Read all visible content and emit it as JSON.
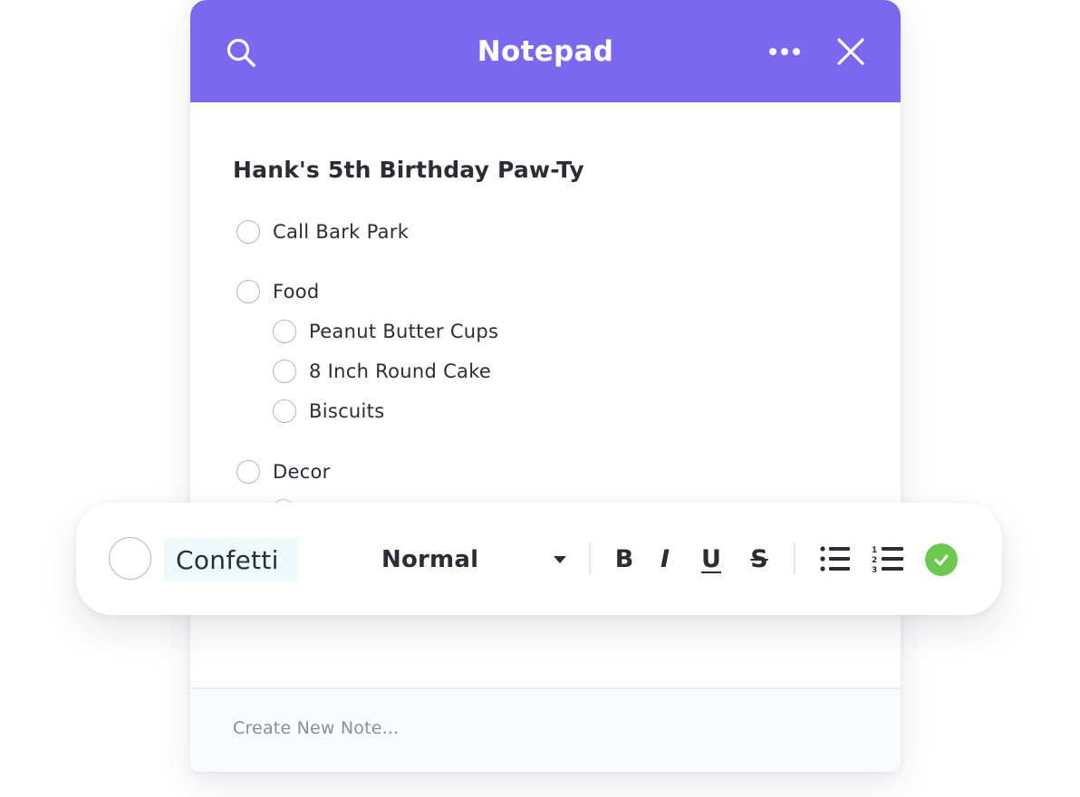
{
  "header": {
    "title": "Notepad",
    "search_icon": "search-icon",
    "more_icon": "more-horizontal-icon",
    "close_icon": "close-icon",
    "accent_color": "#7b68ee"
  },
  "note": {
    "title": "Hank's 5th Birthday Paw-Ty",
    "items": [
      {
        "label": "Call Bark Park",
        "checked": false,
        "indent": 0
      },
      {
        "label": "Food",
        "checked": false,
        "indent": 0
      },
      {
        "label": "Peanut Butter Cups",
        "checked": false,
        "indent": 1
      },
      {
        "label": "8 Inch Round Cake",
        "checked": false,
        "indent": 1
      },
      {
        "label": "Biscuits",
        "checked": false,
        "indent": 1
      },
      {
        "label": "Decor",
        "checked": false,
        "indent": 0
      }
    ]
  },
  "editor_toolbar": {
    "current_item_value": "Confetti",
    "text_style": "Normal",
    "buttons": {
      "bold": "B",
      "italic": "I",
      "underline": "U",
      "strikethrough": "S"
    },
    "list_icons": [
      "bulleted-list-icon",
      "numbered-list-icon"
    ],
    "done_icon": "check-circle-icon",
    "done_color": "#6bc950"
  },
  "footer": {
    "new_note_placeholder": "Create New Note..."
  }
}
